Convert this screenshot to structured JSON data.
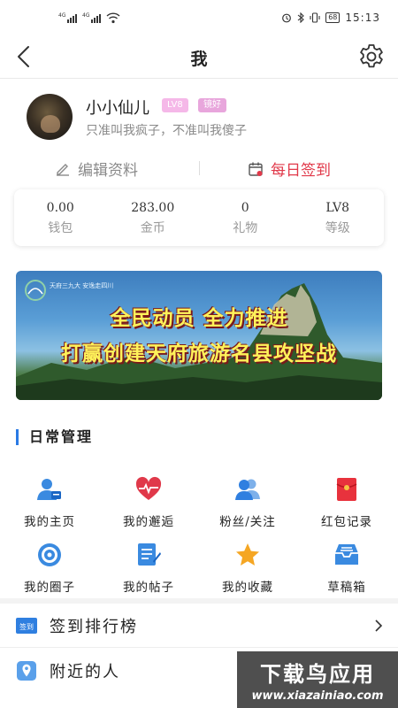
{
  "status_bar": {
    "signal1_label": "4G",
    "signal2_label": "4G",
    "battery": "68",
    "time": "15:13"
  },
  "nav": {
    "title": "我"
  },
  "profile": {
    "name": "小小仙儿",
    "level_badge": "LV8",
    "tag_badge": "镜好",
    "signature": "只准叫我疯子，不准叫我傻子"
  },
  "actions": {
    "edit_label": "编辑资料",
    "signin_label": "每日签到"
  },
  "stats": [
    {
      "value": "0.00",
      "label": "钱包"
    },
    {
      "value": "283.00",
      "label": "金币"
    },
    {
      "value": "0",
      "label": "礼物"
    },
    {
      "value": "LV8",
      "label": "等级"
    }
  ],
  "banner": {
    "line1": "全民动员 全力推进",
    "line2": "打赢创建天府旅游名县攻坚战",
    "logo_text": "天府三九大 安逸走四川"
  },
  "section": {
    "title": "日常管理"
  },
  "grid": [
    {
      "label": "我的主页",
      "icon": "homepage-icon"
    },
    {
      "label": "我的邂逅",
      "icon": "heart-icon"
    },
    {
      "label": "粉丝/关注",
      "icon": "fans-icon"
    },
    {
      "label": "红包记录",
      "icon": "red-envelope-icon"
    },
    {
      "label": "我的圈子",
      "icon": "circle-icon"
    },
    {
      "label": "我的帖子",
      "icon": "posts-icon"
    },
    {
      "label": "我的收藏",
      "icon": "star-icon"
    },
    {
      "label": "草稿箱",
      "icon": "drafts-icon"
    }
  ],
  "list": [
    {
      "label": "签到排行榜",
      "icon_text": "签到"
    },
    {
      "label": "附近的人"
    }
  ],
  "watermark": {
    "line1": "下载鸟应用",
    "line2": "www.xiazainiao.com"
  },
  "colors": {
    "accent_red": "#e1394a",
    "accent_blue": "#2a7ae4",
    "badge_pink": "#f5b8e8"
  }
}
